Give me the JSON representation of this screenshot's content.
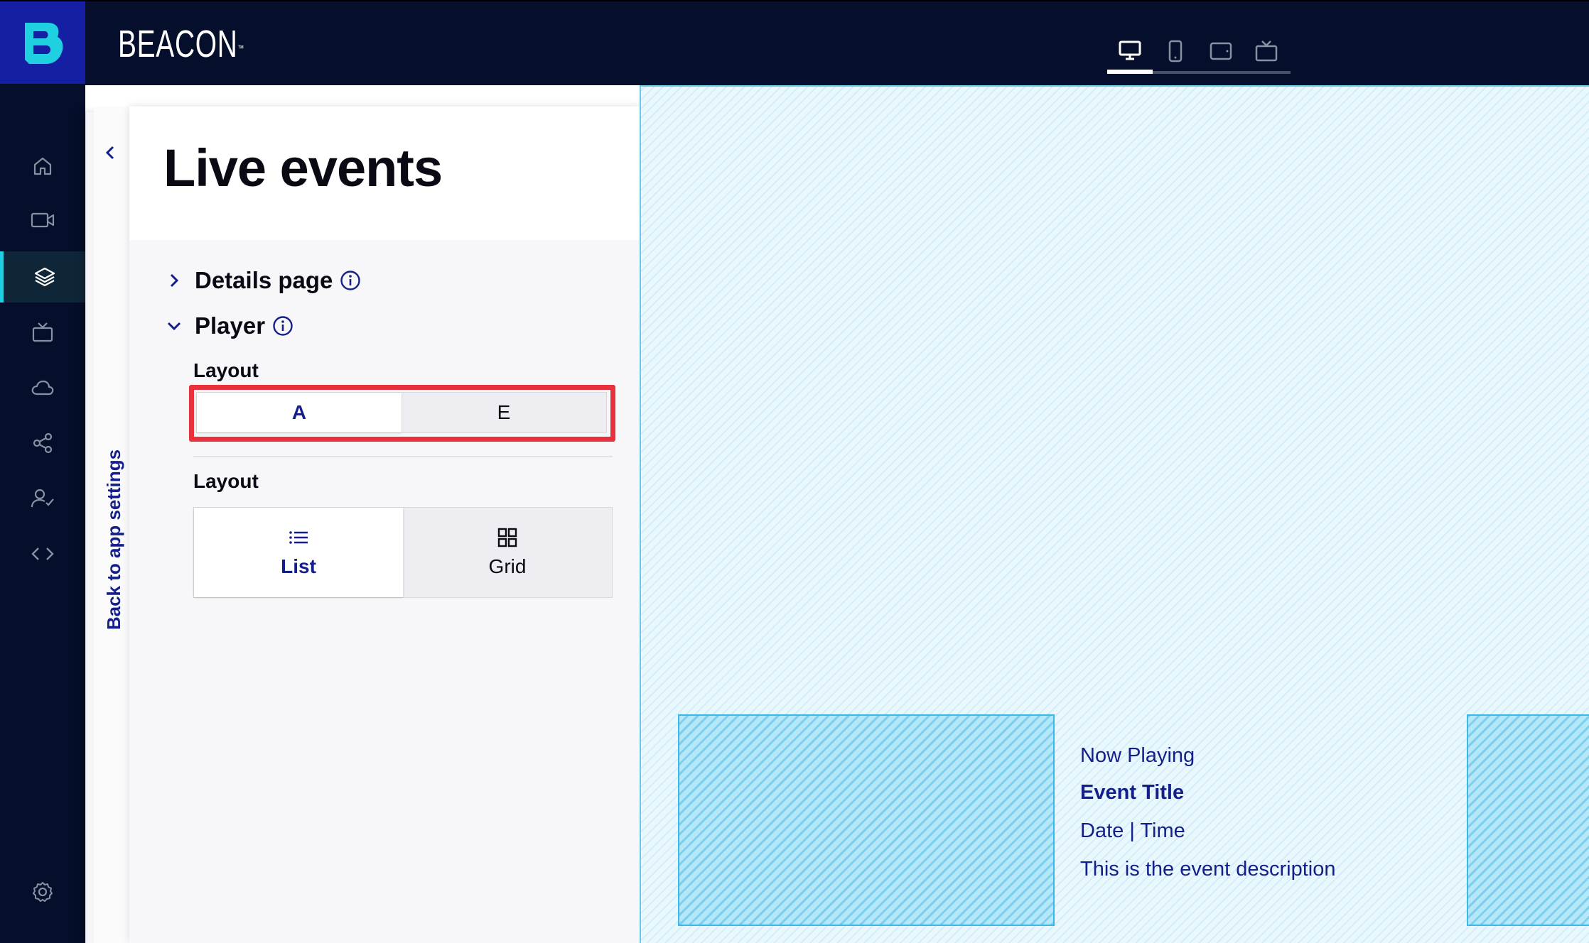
{
  "app": {
    "brand": "BEACON",
    "brand_mark": "™",
    "logo_letter": "B"
  },
  "header": {
    "devices": [
      {
        "name": "desktop",
        "active": true
      },
      {
        "name": "mobile",
        "active": false
      },
      {
        "name": "tablet",
        "active": false
      },
      {
        "name": "tv",
        "active": false
      }
    ]
  },
  "rail": {
    "items": [
      {
        "icon": "home-icon"
      },
      {
        "icon": "video-camera-icon"
      },
      {
        "icon": "layers-icon",
        "active": true
      },
      {
        "icon": "tv-icon"
      },
      {
        "icon": "cloud-icon"
      },
      {
        "icon": "share-icon"
      },
      {
        "icon": "user-check-icon"
      },
      {
        "icon": "code-icon"
      },
      {
        "icon": "settings-icon"
      }
    ]
  },
  "back": {
    "label": "Back to app settings"
  },
  "panel": {
    "title": "Live events",
    "sections": {
      "details": "Details page",
      "player": "Player"
    },
    "player_layout": {
      "label": "Layout",
      "options": [
        "A",
        "E"
      ],
      "selected": "A"
    },
    "layout": {
      "label": "Layout",
      "options": [
        "List",
        "Grid"
      ],
      "selected": "List"
    }
  },
  "preview": {
    "now_playing": "Now Playing",
    "event_title": "Event Title",
    "date_time": "Date | Time",
    "description": "This is the event description"
  },
  "colors": {
    "topbar": "#050e2a",
    "logo_bg": "#141fa4",
    "accent": "#1fd1e0",
    "primary_text": "#141f8a",
    "highlight": "#e8313a",
    "preview_bg": "#eaf7fc"
  }
}
